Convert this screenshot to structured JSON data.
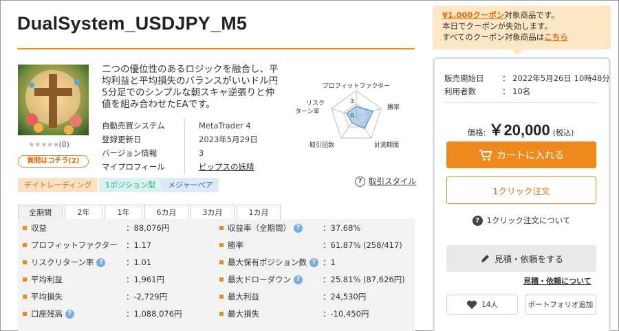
{
  "title": "DualSystem_USDJPY_M5",
  "rating": {
    "stars": "★★★★★",
    "count": "(0)"
  },
  "question_button": "質問はコチラ(2)",
  "description": "二つの優位性のあるロジックを融合し、平均利益と平均損失のバランスがいいドル円5分足でのシンプルな朝スキャ逆張りと仲値を組み合わせたEAです。",
  "meta": [
    {
      "key": "自動売買システム",
      "value": "MetaTrader 4"
    },
    {
      "key": "登録更新日",
      "value": "2023年5月29日"
    },
    {
      "key": "バージョン情報",
      "value": "3"
    },
    {
      "key": "マイプロフィール",
      "value": "ピップスの妖精"
    }
  ],
  "radar": {
    "labels": [
      "プロフィットファクター",
      "勝率",
      "計測期間",
      "取引回数",
      "リスク",
      "ターン率"
    ],
    "scale_labels": [
      "3",
      "0"
    ],
    "values": {
      "profit_factor": 1.2,
      "win_rate": 2.0,
      "period": 2.4,
      "trades": 0.6,
      "risk_return": 1.4
    }
  },
  "tags": [
    "デイトレーディング",
    "1ポジション型",
    "メジャーペア"
  ],
  "trade_style": "取引スタイル",
  "tabs": [
    "全期間",
    "2年",
    "1年",
    "6カ月",
    "3カ月",
    "1カ月"
  ],
  "stats_left": [
    {
      "label": "収益",
      "value": "：88,076円",
      "help": false
    },
    {
      "label": "プロフィットファクター",
      "value": "：1.17",
      "help": false
    },
    {
      "label": "リスクリターン率",
      "value": "：1.01",
      "help": true
    },
    {
      "label": "平均利益",
      "value": "：1,961円",
      "help": false
    },
    {
      "label": "平均損失",
      "value": "：-2,729円",
      "help": false
    },
    {
      "label": "口座残高",
      "value": "：1,088,076円",
      "help": true
    }
  ],
  "stats_right": [
    {
      "label": "収益率（全期間）",
      "value": "：37.68%",
      "help": true
    },
    {
      "label": "勝率",
      "value": "：61.87% (258/417)",
      "help": false
    },
    {
      "label": "最大保有ポジション数",
      "value": "：1",
      "help": true
    },
    {
      "label": "最大ドローダウン",
      "value": "：25.81% (87,626円)",
      "help": true
    },
    {
      "label": "最大利益",
      "value": "：24,530円",
      "help": false
    },
    {
      "label": "最大損失",
      "value": "：-10,450円",
      "help": false
    }
  ],
  "coupon": {
    "highlight": "¥1,000クーポン",
    "line1_rest": "対象商品です。",
    "line2": "本日でクーポンが失効します。",
    "line3_pre": "すべてのクーポン対象商品は",
    "line3_link": "こちら"
  },
  "sale": {
    "start_label": "販売開始日",
    "start_value": "：  2022年5月26日 10時48分",
    "users_label": "利用者数",
    "users_value": "：  10名"
  },
  "price": {
    "label": "価格:",
    "value": "￥20,000",
    "tax": "(税込)"
  },
  "cart_button": "カートに入れる",
  "one_click_button": "1クリック注文",
  "one_click_about": "1クリック注文について",
  "quote_button": "見積・依頼をする",
  "quote_about": "見積・依頼について",
  "favorite_count": "14人",
  "portfolio_button": "ポートフォリオ追加",
  "colors": {
    "accent": "#f08a1c",
    "panel_border": "#dddddd"
  }
}
